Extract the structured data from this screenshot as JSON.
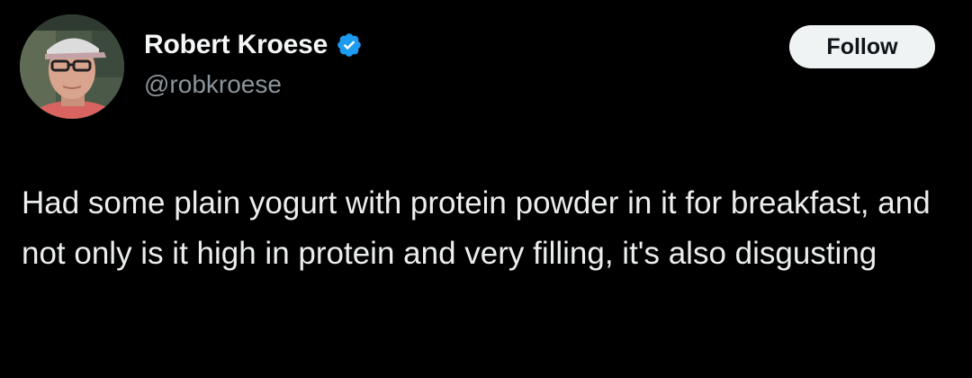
{
  "author": {
    "display_name": "Robert Kroese",
    "handle": "@robkroese",
    "verified": true
  },
  "actions": {
    "follow_label": "Follow"
  },
  "tweet": {
    "text": "Had some plain yogurt with protein powder in it for breakfast, and not only is it high in protein and very filling, it's also disgusting"
  },
  "colors": {
    "background": "#000000",
    "text_primary": "#e7e9ea",
    "text_secondary": "#8b949b",
    "verified_badge": "#1d9bf0",
    "follow_button_bg": "#eff3f4",
    "follow_button_text": "#0f1419"
  },
  "icons": {
    "verified": "verified-badge-icon",
    "avatar": "profile-photo"
  }
}
